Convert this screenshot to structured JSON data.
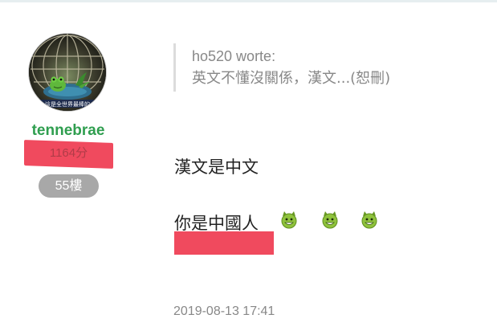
{
  "author": {
    "avatar_caption": "這是全世界最棒的",
    "username": "tennebrae",
    "points": "1164分",
    "floor": "55樓"
  },
  "post": {
    "quote": {
      "author": "ho520 worte:",
      "text": "英文不懂沒關係，漢文...(恕刪)"
    },
    "lines": [
      "漢文是中文",
      "你是中國人"
    ],
    "emoticons": [
      "devil-grin-icon",
      "devil-grin-icon",
      "devil-grin-icon"
    ],
    "timestamp": "2019-08-13 17:41"
  },
  "colors": {
    "username": "#2f9e4f",
    "redaction": "#f04a5e",
    "badge": "#a8a8a8",
    "muted_text": "#888888",
    "emoticon": "#8fc23c"
  }
}
